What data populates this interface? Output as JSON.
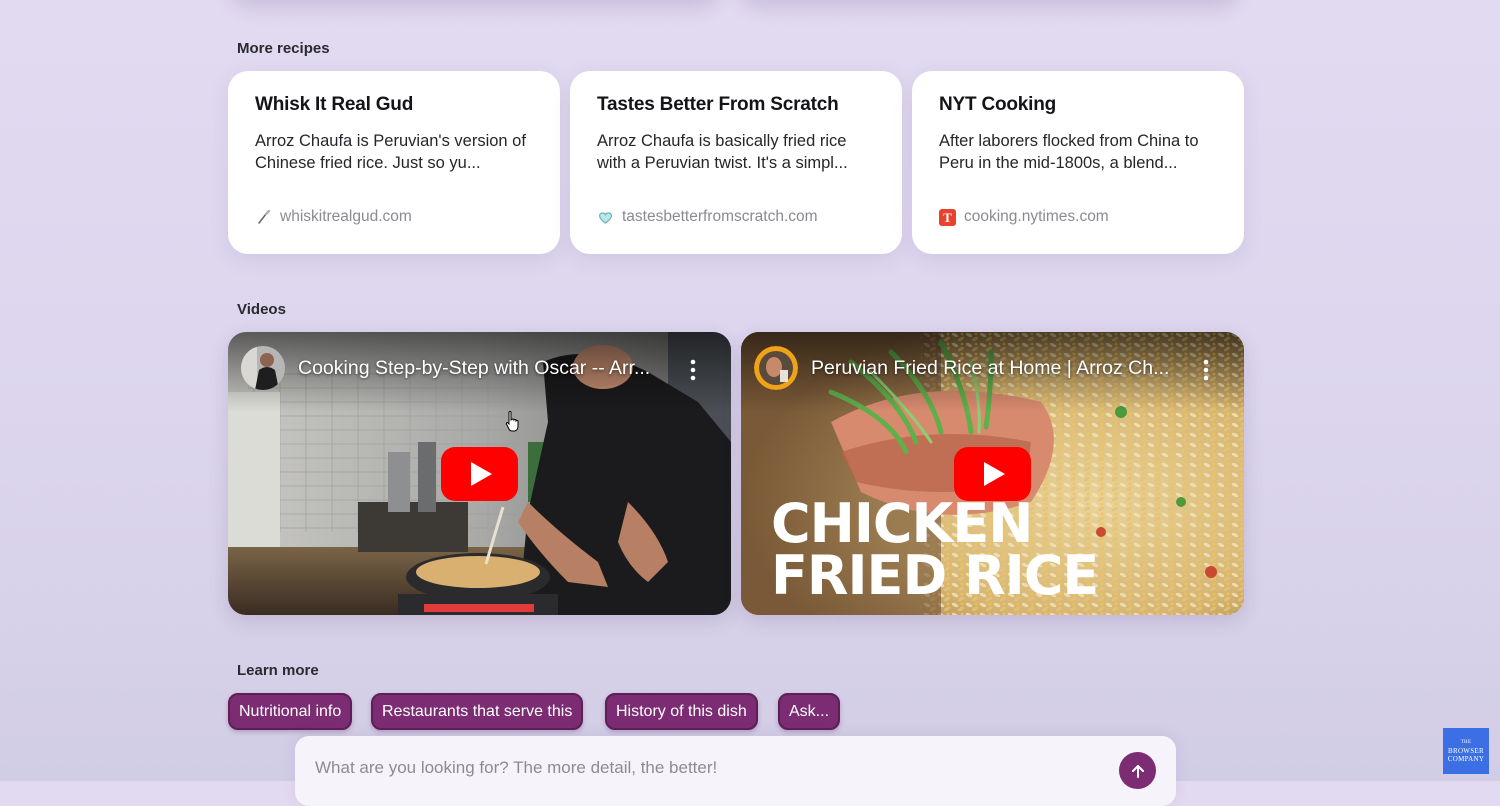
{
  "sections": {
    "recipes_title": "More recipes",
    "videos_title": "Videos",
    "learn_title": "Learn more"
  },
  "recipes": [
    {
      "title": "Whisk It Real Gud",
      "description": "Arroz Chaufa is Peruvian's version of Chinese fried rice. Just so yu...",
      "source": "whiskitrealgud.com",
      "favicon": "whisk-icon"
    },
    {
      "title": "Tastes Better From Scratch",
      "description": "Arroz Chaufa is basically fried rice with a Peruvian twist.  It's a simpl...",
      "source": "tastesbetterfromscratch.com",
      "favicon": "heart-icon"
    },
    {
      "title": "NYT Cooking",
      "description": "After laborers flocked from China to Peru in the mid-1800s, a blend...",
      "source": "cooking.nytimes.com",
      "favicon": "nyt-icon"
    }
  ],
  "videos": [
    {
      "title": "Cooking Step-by-Step with Oscar -- Arr...",
      "thumbnail": "man-cooking-wok-kitchen"
    },
    {
      "title": "Peruvian Fried Rice at Home | Arroz Ch...",
      "thumbnail_text_line1": "CHICKEN",
      "thumbnail_text_line2": "FRIED RICE"
    }
  ],
  "chips": [
    "Nutritional info",
    "Restaurants that serve this",
    "History of this dish",
    "Ask..."
  ],
  "query": {
    "placeholder": "What are you looking for? The more detail, the better!",
    "value": ""
  },
  "brand": {
    "line1": "THE",
    "line2": "BROWSER",
    "line3": "COMPANY"
  },
  "colors": {
    "accent": "#7c2c73",
    "background": "#ddd6ee",
    "youtube_red": "#ff0000",
    "brand_blue": "#3b6fe3"
  }
}
